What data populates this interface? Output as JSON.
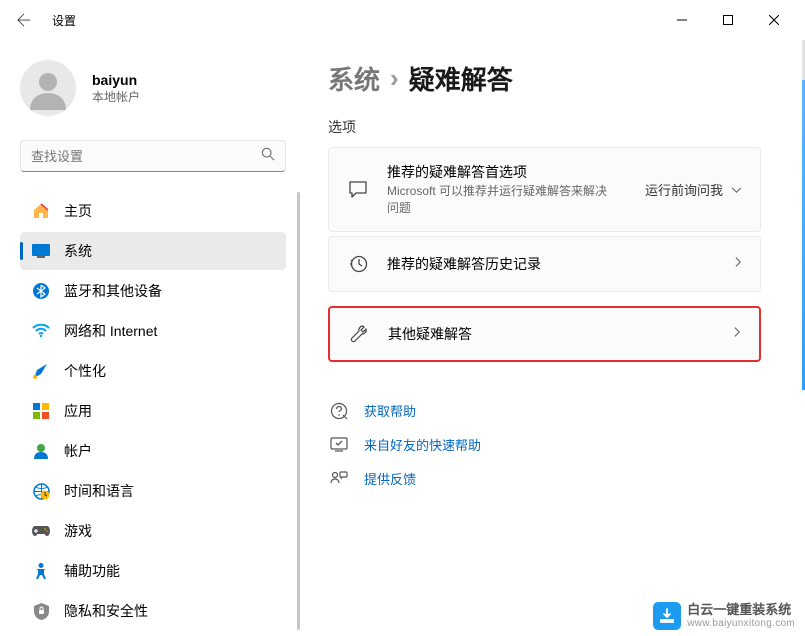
{
  "window": {
    "title": "设置",
    "user_name": "baiyun",
    "user_type": "本地帐户"
  },
  "search": {
    "placeholder": "查找设置"
  },
  "nav": {
    "items": [
      {
        "label": "主页"
      },
      {
        "label": "系统"
      },
      {
        "label": "蓝牙和其他设备"
      },
      {
        "label": "网络和 Internet"
      },
      {
        "label": "个性化"
      },
      {
        "label": "应用"
      },
      {
        "label": "帐户"
      },
      {
        "label": "时间和语言"
      },
      {
        "label": "游戏"
      },
      {
        "label": "辅助功能"
      },
      {
        "label": "隐私和安全性"
      }
    ],
    "active_index": 1
  },
  "breadcrumb": {
    "parent": "系统",
    "separator": "›",
    "current": "疑难解答"
  },
  "section_label": "选项",
  "cards": {
    "pref": {
      "title": "推荐的疑难解答首选项",
      "subtitle": "Microsoft 可以推荐并运行疑难解答来解决问题",
      "trail_text": "运行前询问我"
    },
    "history": {
      "title": "推荐的疑难解答历史记录"
    },
    "other": {
      "title": "其他疑难解答"
    }
  },
  "links": {
    "help": "获取帮助",
    "friend": "来自好友的快速帮助",
    "feedback": "提供反馈"
  },
  "watermark": {
    "title": "白云一键重装系统",
    "url": "www.baiyunxitong.com"
  }
}
